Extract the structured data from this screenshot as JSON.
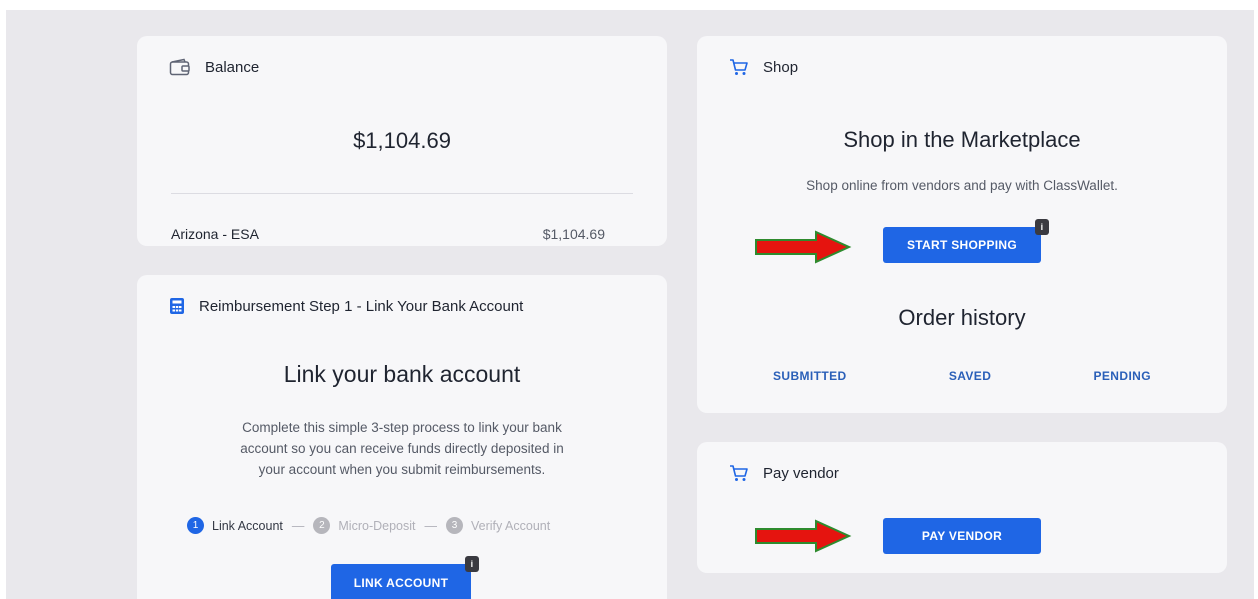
{
  "colors": {
    "accent": "#1f66e5",
    "link": "#2a5fb8",
    "arrow_fill": "#e5140f",
    "arrow_outline": "#2e8b2e"
  },
  "balance": {
    "icon": "wallet-icon",
    "title": "Balance",
    "amount": "$1,104.69",
    "account_name": "Arizona - ESA",
    "account_amount": "$1,104.69"
  },
  "reimbursement": {
    "icon": "calculator-icon",
    "title": "Reimbursement Step 1 - Link Your Bank Account",
    "heading": "Link your bank account",
    "description_lines": [
      "Complete this simple 3-step process to link your bank",
      "account so you can receive funds directly deposited in",
      "your account when you submit reimbursements."
    ],
    "steps": [
      {
        "number": "1",
        "label": "Link Account",
        "active": true
      },
      {
        "number": "2",
        "label": "Micro-Deposit",
        "active": false
      },
      {
        "number": "3",
        "label": "Verify Account",
        "active": false
      }
    ],
    "separator": "—",
    "button_label": "LINK ACCOUNT",
    "button_badge": "i"
  },
  "shop": {
    "icon": "shopping-cart-icon",
    "title": "Shop",
    "heading": "Shop in the Marketplace",
    "description": "Shop online from vendors and pay with ClassWallet.",
    "button_label": "START SHOPPING",
    "button_badge": "i",
    "order_history_heading": "Order history",
    "tabs": [
      "SUBMITTED",
      "SAVED",
      "PENDING"
    ]
  },
  "pay_vendor": {
    "icon": "shopping-cart-icon",
    "title": "Pay vendor",
    "button_label": "PAY VENDOR"
  }
}
